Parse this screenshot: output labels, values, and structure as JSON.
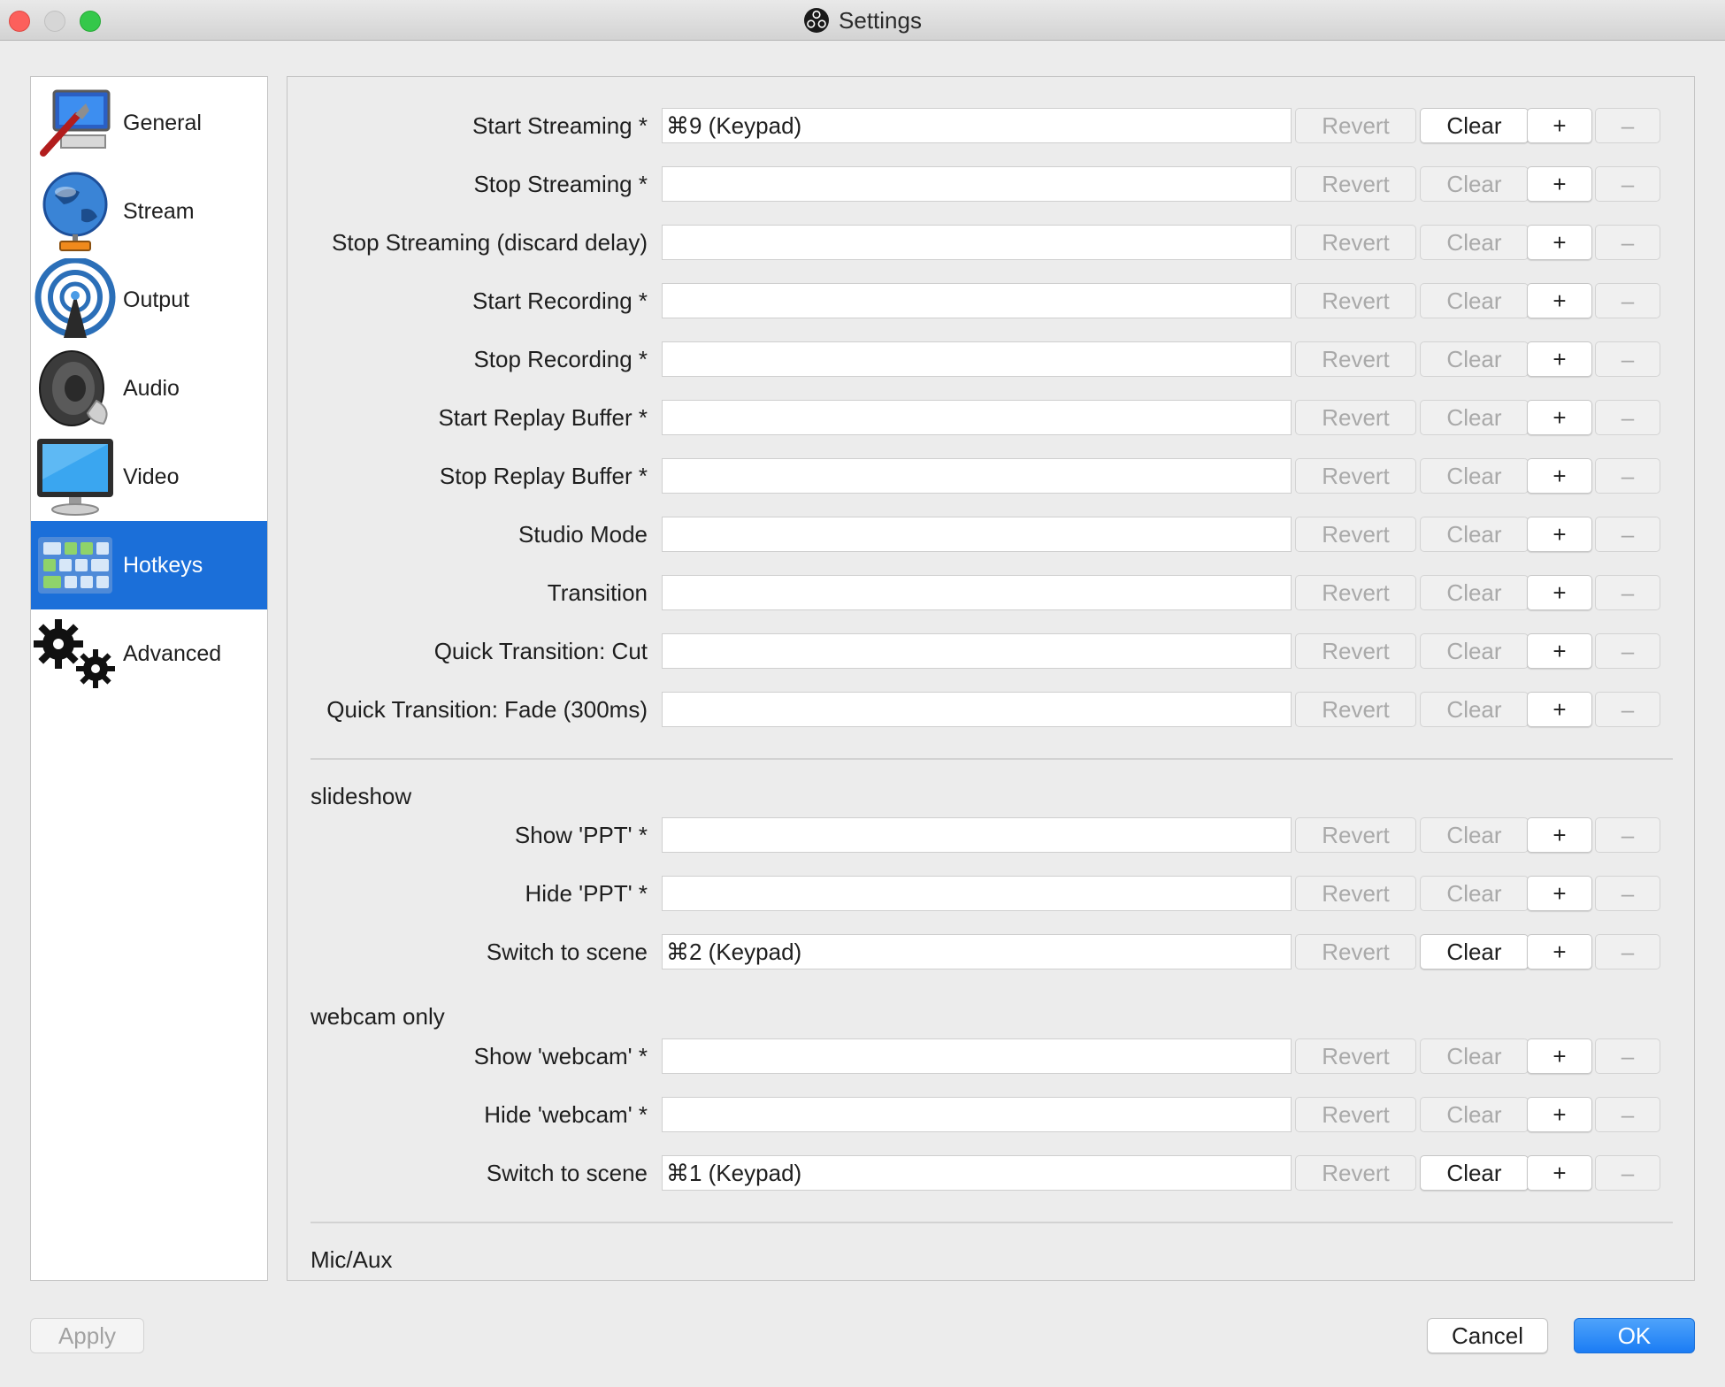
{
  "window": {
    "title": "Settings",
    "icon": "obs-logo-icon"
  },
  "sidebar": {
    "items": [
      {
        "label": "General",
        "icon": "general-settings-icon",
        "active": false
      },
      {
        "label": "Stream",
        "icon": "globe-icon",
        "active": false
      },
      {
        "label": "Output",
        "icon": "broadcast-icon",
        "active": false
      },
      {
        "label": "Audio",
        "icon": "speaker-icon",
        "active": false
      },
      {
        "label": "Video",
        "icon": "monitor-icon",
        "active": false
      },
      {
        "label": "Hotkeys",
        "icon": "keyboard-icon",
        "active": true
      },
      {
        "label": "Advanced",
        "icon": "gears-icon",
        "active": false
      }
    ]
  },
  "hotkeys": {
    "buttons": {
      "revert": "Revert",
      "clear": "Clear",
      "add": "+",
      "remove": "–"
    },
    "rows": [
      {
        "label": "Start Streaming *",
        "value": "⌘9 (Keypad)"
      },
      {
        "label": "Stop Streaming *",
        "value": ""
      },
      {
        "label": "Stop Streaming (discard delay)",
        "value": ""
      },
      {
        "label": "Start Recording *",
        "value": ""
      },
      {
        "label": "Stop Recording *",
        "value": ""
      },
      {
        "label": "Start Replay Buffer *",
        "value": ""
      },
      {
        "label": "Stop Replay Buffer *",
        "value": ""
      },
      {
        "label": "Studio Mode",
        "value": ""
      },
      {
        "label": "Transition",
        "value": ""
      },
      {
        "label": "Quick Transition: Cut",
        "value": ""
      },
      {
        "label": "Quick Transition: Fade (300ms)",
        "value": ""
      },
      {
        "label": "Show 'PPT' *",
        "value": ""
      },
      {
        "label": "Hide 'PPT' *",
        "value": ""
      },
      {
        "label": "Switch to scene",
        "value": "⌘2 (Keypad)"
      },
      {
        "label": "Show 'webcam' *",
        "value": ""
      },
      {
        "label": "Hide 'webcam' *",
        "value": ""
      },
      {
        "label": "Switch to scene",
        "value": "⌘1 (Keypad)"
      }
    ],
    "groups": [
      "slideshow",
      "webcam only",
      "Mic/Aux"
    ]
  },
  "footer": {
    "apply": "Apply",
    "cancel": "Cancel",
    "ok": "OK"
  },
  "colors": {
    "accent": "#1b6fd9",
    "ok_button": "#1b7cf4",
    "close": "#fc605c",
    "maximize": "#34c84a"
  }
}
